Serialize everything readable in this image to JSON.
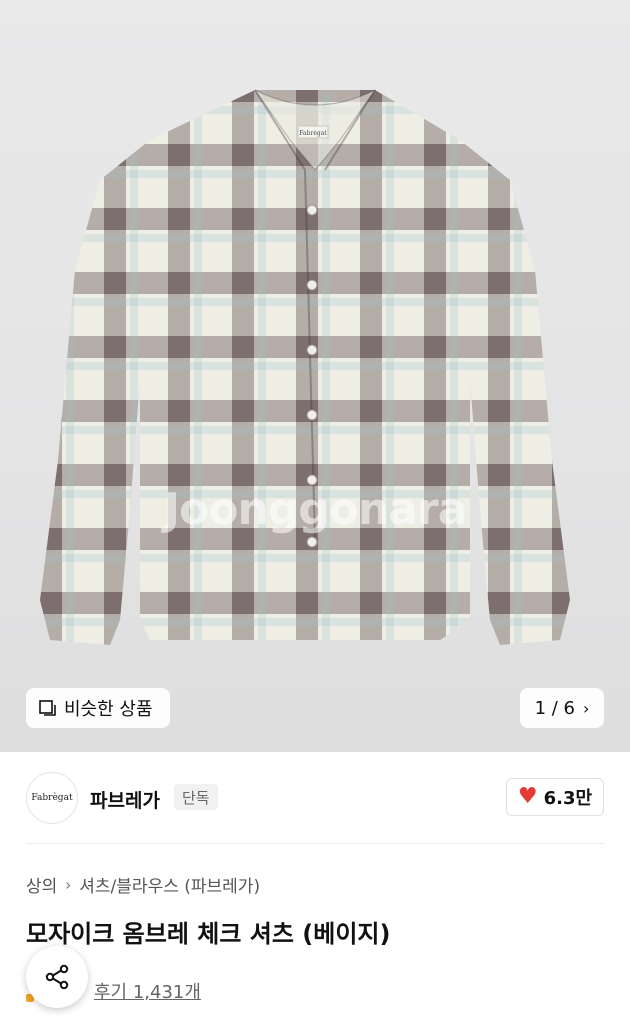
{
  "product_image": {
    "watermark": "Joonggonara",
    "label_tag": "Fabrègat",
    "similar_button": {
      "label": "비슷한 상품",
      "icon": "copy-icon"
    },
    "pagination": {
      "text": "1 / 6",
      "icon": "chevron-right-icon"
    }
  },
  "brand": {
    "logo_text": "Fabrègat",
    "name": "파브레가",
    "badge": "단독",
    "likes": "6.3만",
    "like_icon": "heart-icon",
    "like_color": "#e53935"
  },
  "breadcrumb": {
    "level1": "상의",
    "level2": "셔츠/블라우스 (파브레가)"
  },
  "product": {
    "title": "모자이크 옴브레 체크 셔츠 (베이지)",
    "review": "후기 1,431개"
  },
  "share": {
    "icon": "share-icon"
  }
}
